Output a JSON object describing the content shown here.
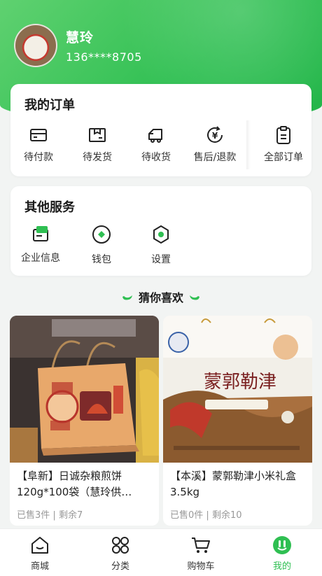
{
  "profile": {
    "name": "慧玲",
    "phone": "136****8705"
  },
  "orders": {
    "title": "我的订单",
    "items": [
      {
        "label": "待付款",
        "icon": "card-icon"
      },
      {
        "label": "待发货",
        "icon": "box-icon"
      },
      {
        "label": "待收货",
        "icon": "truck-icon"
      },
      {
        "label": "售后/退款",
        "icon": "refund-icon"
      },
      {
        "label": "全部订单",
        "icon": "clipboard-icon"
      }
    ]
  },
  "services": {
    "title": "其他服务",
    "items": [
      {
        "label": "企业信息",
        "icon": "company-icon"
      },
      {
        "label": "钱包",
        "icon": "wallet-icon"
      },
      {
        "label": "设置",
        "icon": "settings-icon"
      }
    ]
  },
  "guess": {
    "title": "猜你喜欢"
  },
  "products": [
    {
      "title": "【阜新】日诚杂粮煎饼120g*100袋（慧玲供…",
      "sold": "已售3件",
      "sep": "|",
      "remain": "剩余7"
    },
    {
      "title": "【本溪】蒙郭勒津小米礼盒3.5kg",
      "sold": "已售0件",
      "sep": "|",
      "remain": "剩余10",
      "image_text": "蒙郭勒津"
    }
  ],
  "tabbar": {
    "items": [
      {
        "label": "商城",
        "icon": "home-icon"
      },
      {
        "label": "分类",
        "icon": "category-icon"
      },
      {
        "label": "购物车",
        "icon": "cart-icon"
      },
      {
        "label": "我的",
        "icon": "profile-icon",
        "active": true
      }
    ]
  },
  "colors": {
    "primary": "#2fbf52",
    "background": "#f2f4f3",
    "text": "#222222",
    "muted": "#999999"
  }
}
